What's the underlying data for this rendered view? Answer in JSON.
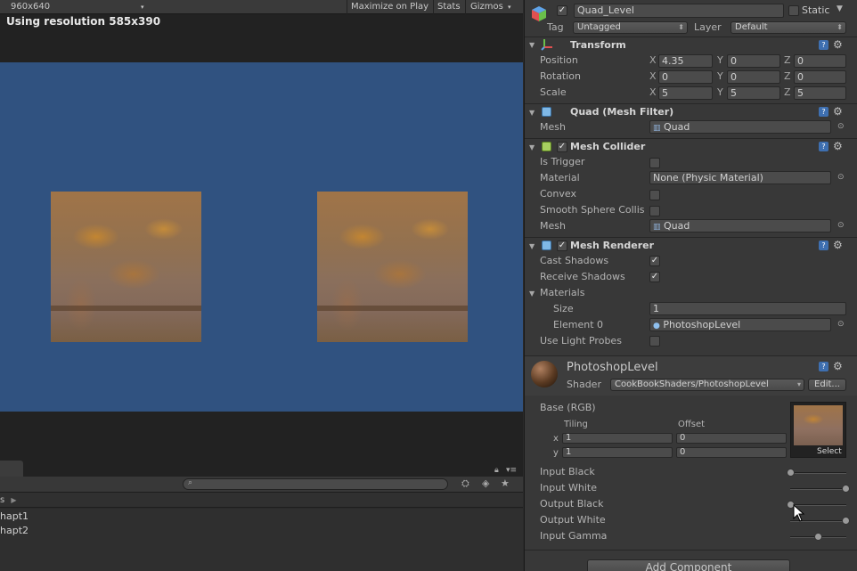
{
  "game_view": {
    "resolution_dropdown": "960x640",
    "toolbar": {
      "maximize_on_play": "Maximize on Play",
      "stats": "Stats",
      "gizmos": "Gizmos"
    },
    "resolution_notice": "Using resolution 585x390",
    "background_color": "#305280"
  },
  "project_panel": {
    "crumb_fragment": "s",
    "items": [
      "hapt1",
      "hapt2"
    ]
  },
  "inspector": {
    "object_name": "Quad_Level",
    "static_label": "Static",
    "tag_label": "Tag",
    "tag_value": "Untagged",
    "layer_label": "Layer",
    "layer_value": "Default",
    "transform": {
      "title": "Transform",
      "position": {
        "label": "Position",
        "x": "4.35",
        "y": "0",
        "z": "0"
      },
      "rotation": {
        "label": "Rotation",
        "x": "0",
        "y": "0",
        "z": "0"
      },
      "scale": {
        "label": "Scale",
        "x": "5",
        "y": "5",
        "z": "5"
      },
      "axis_x": "X",
      "axis_y": "Y",
      "axis_z": "Z"
    },
    "mesh_filter": {
      "title": "Quad (Mesh Filter)",
      "mesh_label": "Mesh",
      "mesh_value": "Quad"
    },
    "mesh_collider": {
      "title": "Mesh Collider",
      "is_trigger_label": "Is Trigger",
      "material_label": "Material",
      "material_value": "None (Physic Material)",
      "convex_label": "Convex",
      "smooth_label": "Smooth Sphere Collis",
      "mesh_label": "Mesh",
      "mesh_value": "Quad"
    },
    "mesh_renderer": {
      "title": "Mesh Renderer",
      "cast_shadows_label": "Cast Shadows",
      "receive_shadows_label": "Receive Shadows",
      "materials_label": "Materials",
      "size_label": "Size",
      "size_value": "1",
      "element0_label": "Element 0",
      "element0_value": "PhotoshopLevel",
      "light_probes_label": "Use Light Probes"
    },
    "material": {
      "name": "PhotoshopLevel",
      "shader_label": "Shader",
      "shader_value": "CookBookShaders/PhotoshopLevel",
      "edit_button": "Edit...",
      "base_label": "Base (RGB)",
      "tiling_label": "Tiling",
      "offset_label": "Offset",
      "x_label": "x",
      "y_label": "y",
      "tiling_x": "1",
      "tiling_y": "1",
      "offset_x": "0",
      "offset_y": "0",
      "select_label": "Select",
      "sliders": [
        {
          "label": "Input Black",
          "value": 0.0
        },
        {
          "label": "Input White",
          "value": 1.0
        },
        {
          "label": "Output Black",
          "value": 0.0
        },
        {
          "label": "Output White",
          "value": 1.0
        },
        {
          "label": "Input Gamma",
          "value": 0.5
        }
      ]
    },
    "add_component": "Add Component"
  },
  "colors": {
    "scene_blue": "#305280",
    "panel_bg": "#383838",
    "help_blue": "#3e6fb0"
  }
}
